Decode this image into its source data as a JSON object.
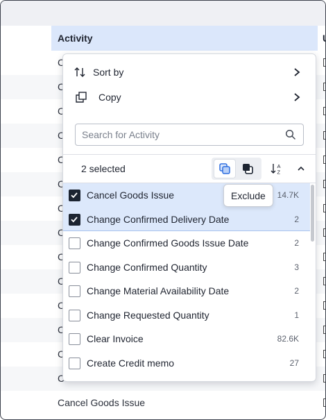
{
  "table": {
    "column_header": "Activity",
    "next_column_partial": "U",
    "rows": [
      "C",
      "C",
      "C",
      "C",
      "C",
      "C",
      "C",
      "C",
      "C",
      "C",
      "C",
      "C",
      "C",
      "Cancel Goods Issue",
      "Cancel Goods Issue"
    ]
  },
  "menu": {
    "sort_by_label": "Sort by",
    "copy_label": "Copy"
  },
  "search": {
    "placeholder": "Search for Activity",
    "value": ""
  },
  "toolbar": {
    "selected_text": "2 selected",
    "tooltip": "Exclude"
  },
  "items": [
    {
      "label": "Cancel Goods Issue",
      "count": "14.7K",
      "checked": true
    },
    {
      "label": "Change Confirmed Delivery Date",
      "count": "2",
      "checked": true
    },
    {
      "label": "Change Confirmed Goods Issue Date",
      "count": "2",
      "checked": false
    },
    {
      "label": "Change Confirmed Quantity",
      "count": "3",
      "checked": false
    },
    {
      "label": "Change Material Availability Date",
      "count": "2",
      "checked": false
    },
    {
      "label": "Change Requested Quantity",
      "count": "1",
      "checked": false
    },
    {
      "label": "Clear Invoice",
      "count": "82.6K",
      "checked": false
    },
    {
      "label": "Create Credit memo",
      "count": "27",
      "checked": false
    }
  ],
  "icons": {
    "filter": "user-filter-icon",
    "sort": "sort-arrows-icon",
    "copy": "copy-icon",
    "search": "search-icon",
    "include": "include-overlap-icon",
    "exclude": "exclude-overlap-icon",
    "sort_az": "sort-az-icon",
    "collapse": "chevron-up-icon"
  },
  "colors": {
    "header_highlight": "#dbe7fb",
    "selected_row": "#dce8fb",
    "checkbox_on": "#1c2431",
    "include_accent": "#2f6fe0"
  }
}
